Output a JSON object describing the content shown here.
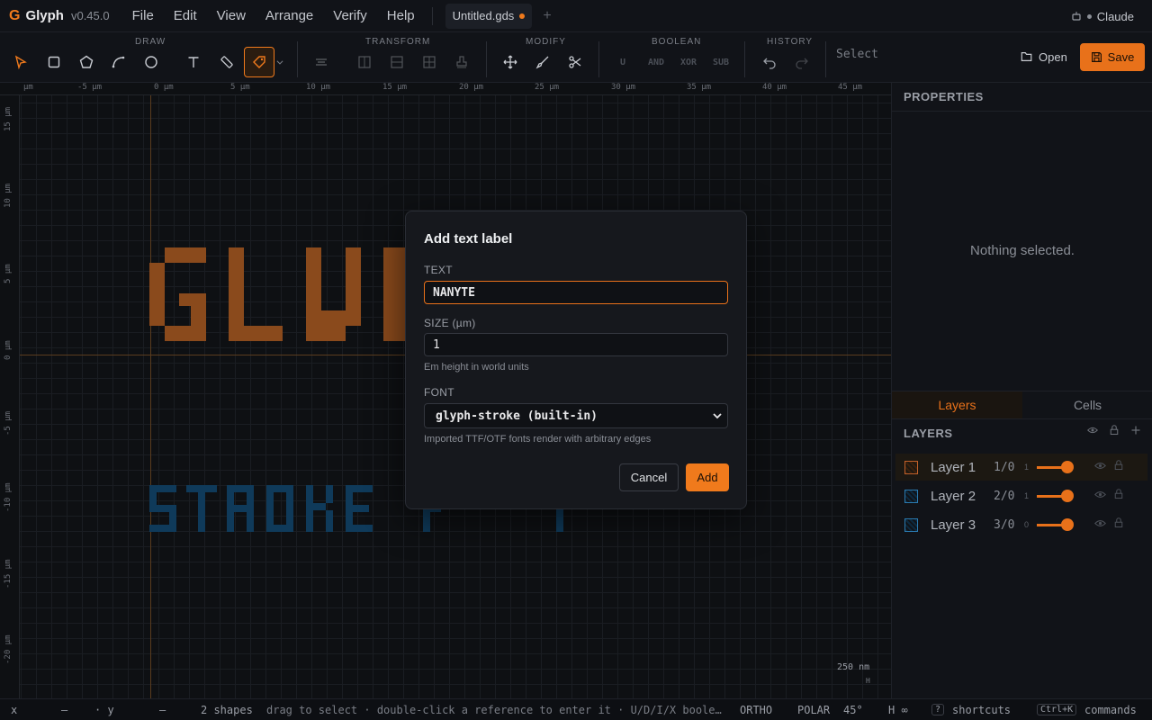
{
  "app": {
    "logo_glyph": "G",
    "name": "Glyph",
    "version": "v0.45.0"
  },
  "menu": [
    "File",
    "Edit",
    "View",
    "Arrange",
    "Verify",
    "Help"
  ],
  "tab": {
    "title": "Untitled.gds",
    "new_tab": "+"
  },
  "account": {
    "name": "Claude",
    "icon": "robot-icon"
  },
  "toolbar": {
    "groups": [
      "DRAW",
      "TRANSFORM",
      "MODIFY",
      "BOOLEAN",
      "HISTORY"
    ],
    "boolean_ops": [
      "U",
      "AND",
      "XOR",
      "SUB"
    ],
    "mode": "Select",
    "open_label": "Open",
    "save_label": "Save"
  },
  "canvas": {
    "ruler_x": [
      "µm",
      "-5 µm",
      "0 µm",
      "5 µm",
      "10 µm",
      "15 µm",
      "20 µm",
      "25 µm",
      "30 µm",
      "35 µm",
      "40 µm",
      "45 µm"
    ],
    "ruler_y": [
      "15 µm",
      "10 µm",
      "5 µm",
      "0 µm",
      "-5 µm",
      "-10 µm",
      "-15 µm",
      "-20 µm"
    ],
    "scale": "250 nm",
    "scale_unit": "H",
    "layer1_color": "#8a4a1c",
    "layer2_color": "#0f3a5a"
  },
  "properties": {
    "title": "PROPERTIES",
    "empty": "Nothing selected."
  },
  "layers_panel": {
    "tabs": [
      "Layers",
      "Cells"
    ],
    "title": "LAYERS",
    "rows": [
      {
        "name": "Layer 1",
        "num": "1/0",
        "small": "1",
        "color": "#c0602a"
      },
      {
        "name": "Layer 2",
        "num": "2/0",
        "small": "1",
        "color": "#2a7ab0"
      },
      {
        "name": "Layer 3",
        "num": "3/0",
        "small": "0",
        "color": "#2a7ab0"
      }
    ]
  },
  "status": {
    "x_label": "x",
    "x_val": "—",
    "y_label": "· y",
    "y_val": "—",
    "shapes": "2 shapes",
    "hint": "drag to select · double-click a reference to enter it · U/D/I/X boole…",
    "ortho": "ORTHO",
    "polar": "POLAR",
    "angle": "45°",
    "h": "H ∞",
    "shortcuts_key": "?",
    "shortcuts": "shortcuts",
    "commands_key": "Ctrl+K",
    "commands": "commands"
  },
  "dialog": {
    "title": "Add text label",
    "text_label": "TEXT",
    "text_value": "NANYTE",
    "size_label": "SIZE (µm)",
    "size_value": "1",
    "size_help": "Em height in world units",
    "font_label": "FONT",
    "font_value": "glyph-stroke (built-in)",
    "font_help": "Imported TTF/OTF fonts render with arbitrary edges",
    "cancel": "Cancel",
    "add": "Add"
  }
}
